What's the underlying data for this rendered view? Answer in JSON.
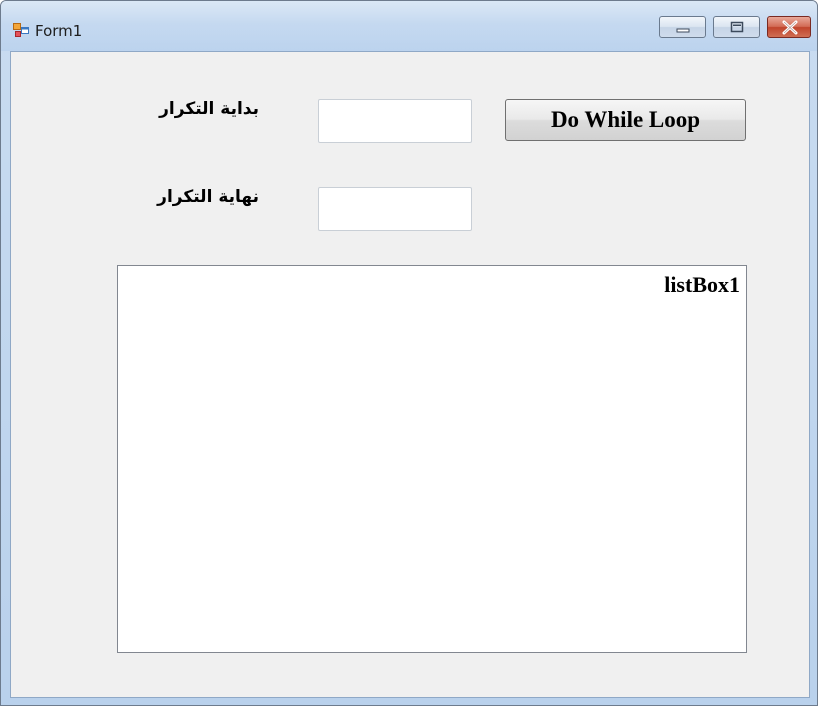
{
  "window": {
    "title": "Form1"
  },
  "title_bar": {
    "icon": "form-app-icon",
    "buttons": [
      "minimize-icon",
      "maximize-icon",
      "close-icon"
    ],
    "close_color": "#c0442c"
  },
  "form": {
    "start_label": "بداية التكرار",
    "end_label": "نهاية التكرار",
    "start_value": "",
    "end_value": "",
    "loop_button_label": "Do While Loop",
    "listbox_name": "listBox1"
  }
}
